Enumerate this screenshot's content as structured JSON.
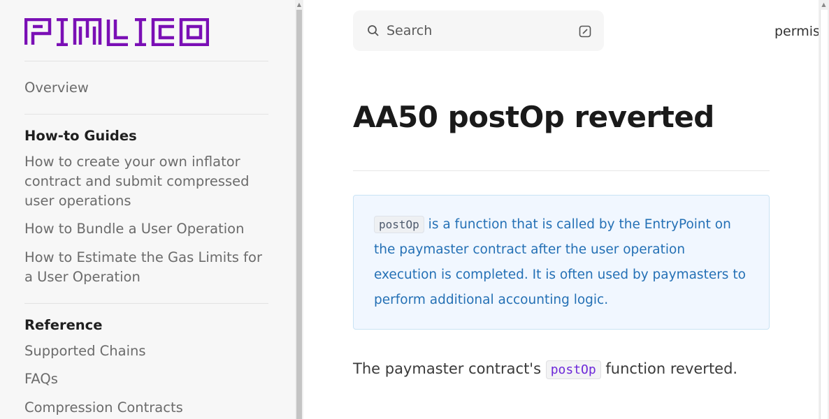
{
  "colors": {
    "brand_purple": "#7a0fb5",
    "sidebar_bg": "#f7f7f7",
    "info_bg": "#f1f7ff",
    "info_border": "#c9e3f4",
    "info_text": "#2470b5",
    "code_purple": "#6d28d9"
  },
  "logo": {
    "alt": "PIMLICO"
  },
  "sidebar": {
    "overview": "Overview",
    "howto_heading": "How-to Guides",
    "howto_items": [
      "How to create your own inflator contract and submit compressed user operations",
      "How to Bundle a User Operation",
      "How to Estimate the Gas Limits for a User Operation"
    ],
    "reference_heading": "Reference",
    "reference_items": [
      "Supported Chains",
      "FAQs",
      "Compression Contracts"
    ]
  },
  "search": {
    "label": "Search",
    "icon": "search-icon",
    "action_icon": "edit-icon"
  },
  "header": {
    "top_link": "permis"
  },
  "main": {
    "title": "AA50 postOp reverted",
    "info": {
      "code": "postOp",
      "text": " is a function that is called by the EntryPoint on the paymaster contract after the user operation execution is completed. It is often used by paymasters to perform additional accounting logic."
    },
    "body": {
      "before": "The paymaster contract's ",
      "code": "postOp",
      "after": " function reverted."
    }
  }
}
